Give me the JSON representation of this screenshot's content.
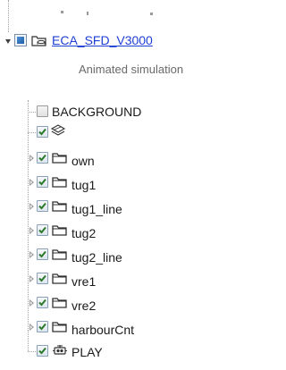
{
  "root": {
    "title": "ECA_SFD_V3000",
    "subtitle": "Animated simulation"
  },
  "items": [
    {
      "label": "BACKGROUND",
      "checked": false,
      "icon": "none"
    },
    {
      "label": "",
      "checked": true,
      "icon": "layers-icon"
    },
    {
      "label": "own",
      "checked": true,
      "icon": "folder-icon"
    },
    {
      "label": "tug1",
      "checked": true,
      "icon": "folder-icon"
    },
    {
      "label": "tug1_line",
      "checked": true,
      "icon": "folder-icon"
    },
    {
      "label": "tug2",
      "checked": true,
      "icon": "folder-icon"
    },
    {
      "label": "tug2_line",
      "checked": true,
      "icon": "folder-icon"
    },
    {
      "label": "vre1",
      "checked": true,
      "icon": "folder-icon"
    },
    {
      "label": "vre2",
      "checked": true,
      "icon": "folder-icon"
    },
    {
      "label": "harbourCnt",
      "checked": true,
      "icon": "folder-icon"
    },
    {
      "label": "PLAY",
      "checked": true,
      "icon": "play-control-icon"
    }
  ],
  "colors": {
    "link": "#1d3fd6",
    "subtitle": "#6a6a6a",
    "check": "#2a7a2a"
  }
}
